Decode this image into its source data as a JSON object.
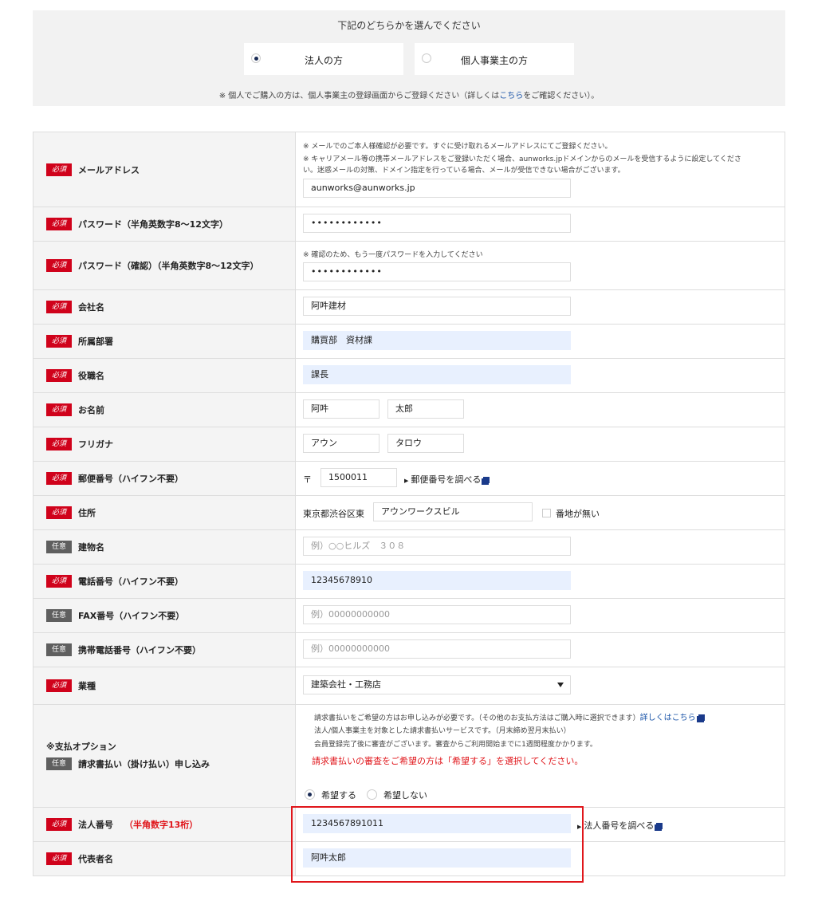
{
  "selector": {
    "title": "下記のどちらかを選んでください",
    "option_corp": "法人の方",
    "option_sole": "個人事業主の方",
    "note_prefix": "※ 個人でご購入の方は、個人事業主の登録画面からご登録ください（詳しくは",
    "note_link": "こちら",
    "note_suffix": "をご確認ください）。"
  },
  "badges": {
    "required": "必須",
    "optional": "任意"
  },
  "email": {
    "label": "メールアドレス",
    "note1": "※ メールでのご本人様確認が必要です。すぐに受け取れるメールアドレスにてご登録ください。",
    "note2a": "※ キャリアメール等の携帯メールアドレスをご登録いただく場合、aunworks.jpドメインからのメールを受信するように設定してくださ",
    "note2b": "い。迷惑メールの対策、ドメイン指定を行っている場合、メールが受信できない場合がございます。",
    "value": "aunworks@aunworks.jp"
  },
  "password": {
    "label": "パスワード（半角英数字8〜12文字）",
    "value": "••••••••••••"
  },
  "password_confirm": {
    "label": "パスワード（確認）（半角英数字8〜12文字）",
    "note": "※ 確認のため、もう一度パスワードを入力してください",
    "value": "••••••••••••"
  },
  "company": {
    "label": "会社名",
    "value": "阿吽建材"
  },
  "department": {
    "label": "所属部署",
    "value": "購買部　資材課"
  },
  "position": {
    "label": "役職名",
    "value": "課長"
  },
  "name": {
    "label": "お名前",
    "last": "阿吽",
    "first": "太郎"
  },
  "furigana": {
    "label": "フリガナ",
    "last": "アウン",
    "first": "タロウ"
  },
  "postal": {
    "label": "郵便番号（ハイフン不要）",
    "mark": "〒",
    "value": "1500011",
    "link": "郵便番号を調べる"
  },
  "address": {
    "label": "住所",
    "prefix": "東京都渋谷区東",
    "value": "アウンワークスビル",
    "no_number": "番地が無い"
  },
  "building": {
    "label": "建物名",
    "placeholder": "例）○○ヒルズ　３０８"
  },
  "phone": {
    "label": "電話番号（ハイフン不要）",
    "value": "12345678910"
  },
  "fax": {
    "label": "FAX番号（ハイフン不要）",
    "placeholder": "例）00000000000"
  },
  "mobile": {
    "label": "携帯電話番号（ハイフン不要）",
    "placeholder": "例）00000000000"
  },
  "industry": {
    "label": "業種",
    "value": "建築会社・工務店"
  },
  "payment": {
    "label_title": "※支払オプション",
    "label": "請求書払い（掛け払い）申し込み",
    "text1": "請求書払いをご希望の方はお申し込みが必要です。（その他のお支払方法はご購入時に選択できます）",
    "text1_link": "詳しくはこちら",
    "text2": "法人/個人事業主を対象とした請求書払いサービスです。（月末締め翌月末払い）",
    "text3": "会員登録完了後に審査がございます。審査からご利用開始までに1週間程度かかります。",
    "notice": "請求書払いの審査をご希望の方は「希望する」を選択してください。",
    "opt_yes": "希望する",
    "opt_no": "希望しない"
  },
  "corp_number": {
    "label": "法人番号",
    "sub": "（半角数字13桁）",
    "value": "1234567891011",
    "link": "法人番号を調べる"
  },
  "representative": {
    "label": "代表者名",
    "value": "阿吽太郎"
  }
}
